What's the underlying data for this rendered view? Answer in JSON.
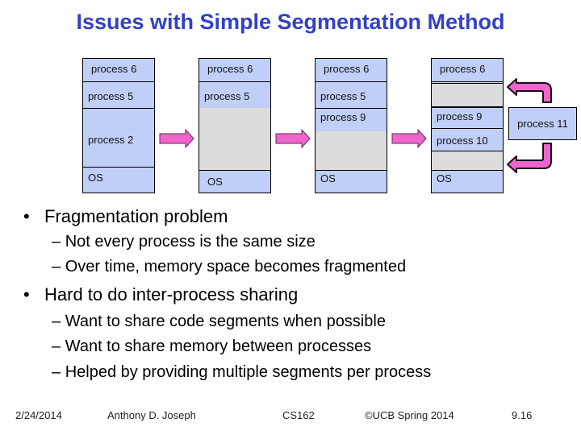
{
  "title": "Issues with Simple Segmentation Method",
  "diagram": {
    "columns": [
      {
        "segments": [
          {
            "label": "process 6",
            "kind": "process"
          },
          {
            "label": "process 5",
            "kind": "process"
          },
          {
            "label": "process 2",
            "kind": "process"
          },
          {
            "label": "OS",
            "kind": "process"
          }
        ]
      },
      {
        "segments": [
          {
            "label": "process 6",
            "kind": "process"
          },
          {
            "label": "process 5",
            "kind": "process"
          },
          {
            "label": "",
            "kind": "free"
          },
          {
            "label": "OS",
            "kind": "process"
          }
        ]
      },
      {
        "segments": [
          {
            "label": "process 6",
            "kind": "process"
          },
          {
            "label": "process 5",
            "kind": "process"
          },
          {
            "label": "process 9",
            "kind": "process"
          },
          {
            "label": "",
            "kind": "free"
          },
          {
            "label": "OS",
            "kind": "process"
          }
        ]
      },
      {
        "segments": [
          {
            "label": "process 6",
            "kind": "process"
          },
          {
            "label": "",
            "kind": "free"
          },
          {
            "label": "process 9",
            "kind": "process"
          },
          {
            "label": "process 10",
            "kind": "process"
          },
          {
            "label": "",
            "kind": "free"
          },
          {
            "label": "OS",
            "kind": "process"
          }
        ]
      }
    ],
    "incoming_process": "process 11",
    "colors": {
      "process_fill": "#c0cff8",
      "free_fill": "#dcdcdc",
      "arrow_fill": "#ee66cc",
      "title": "#3240c8"
    }
  },
  "bullets": [
    {
      "text": "Fragmentation problem",
      "sub": [
        "Not every process is the same size",
        "Over time, memory space becomes fragmented"
      ]
    },
    {
      "text": "Hard to do inter-process sharing",
      "sub": [
        "Want to share code segments when possible",
        "Want to share memory between processes",
        "Helped by providing multiple segments per process"
      ]
    }
  ],
  "footer": {
    "date": "2/24/2014",
    "author": "Anthony D. Joseph",
    "course": "CS162",
    "copyright": "©UCB Spring 2014",
    "slide_number": "9.16"
  }
}
